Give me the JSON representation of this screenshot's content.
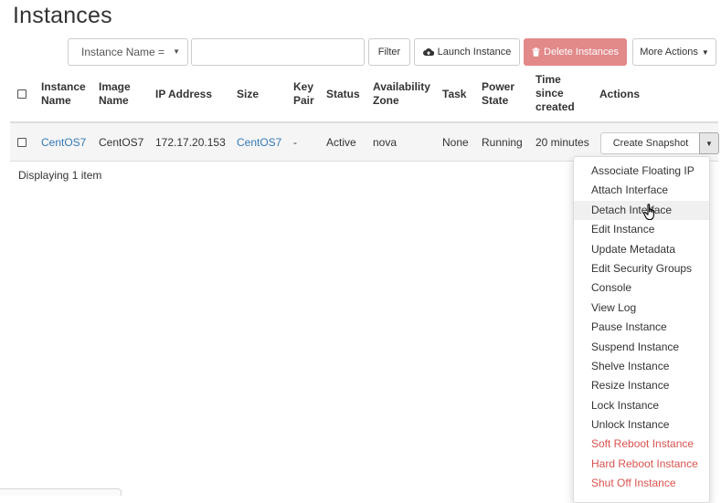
{
  "page": {
    "title": "Instances"
  },
  "toolbar": {
    "filter_field": "Instance Name =",
    "filter_value": "",
    "filter_label": "Filter",
    "launch_label": "Launch Instance",
    "delete_label": "Delete Instances",
    "more_label": "More Actions"
  },
  "table": {
    "headers": {
      "instance_name": [
        "Instance",
        "Name"
      ],
      "image_name": [
        "Image",
        "Name"
      ],
      "ip_address": "IP Address",
      "size": "Size",
      "key_pair": [
        "Key",
        "Pair"
      ],
      "status": "Status",
      "availability_zone": [
        "Availability",
        "Zone"
      ],
      "task": "Task",
      "power_state": [
        "Power",
        "State"
      ],
      "time_since_created": [
        "Time",
        "since",
        "created"
      ],
      "actions": "Actions"
    },
    "rows": [
      {
        "instance_name": "CentOS7",
        "image_name": "CentOS7",
        "ip_address": "172.17.20.153",
        "size": "CentOS7",
        "key_pair": "-",
        "status": "Active",
        "availability_zone": "nova",
        "task": "None",
        "power_state": "Running",
        "time_since_created": "20 minutes",
        "action_label": "Create Snapshot"
      }
    ],
    "summary": "Displaying 1 item"
  },
  "menu": {
    "items": [
      "Associate Floating IP",
      "Attach Interface",
      "Detach Interface",
      "Edit Instance",
      "Update Metadata",
      "Edit Security Groups",
      "Console",
      "View Log",
      "Pause Instance",
      "Suspend Instance",
      "Shelve Instance",
      "Resize Instance",
      "Lock Instance",
      "Unlock Instance",
      "Soft Reboot Instance",
      "Hard Reboot Instance",
      "Shut Off Instance"
    ],
    "hovered_item": "Detach Interface"
  },
  "colors": {
    "link": "#337ab7",
    "danger": "#d9534f",
    "delete_button": "#e2898a"
  },
  "icons": {
    "launch": "cloud-upload-icon",
    "delete": "trash-icon",
    "more": "caret-down-icon",
    "cursor": "hand-pointer-icon"
  }
}
